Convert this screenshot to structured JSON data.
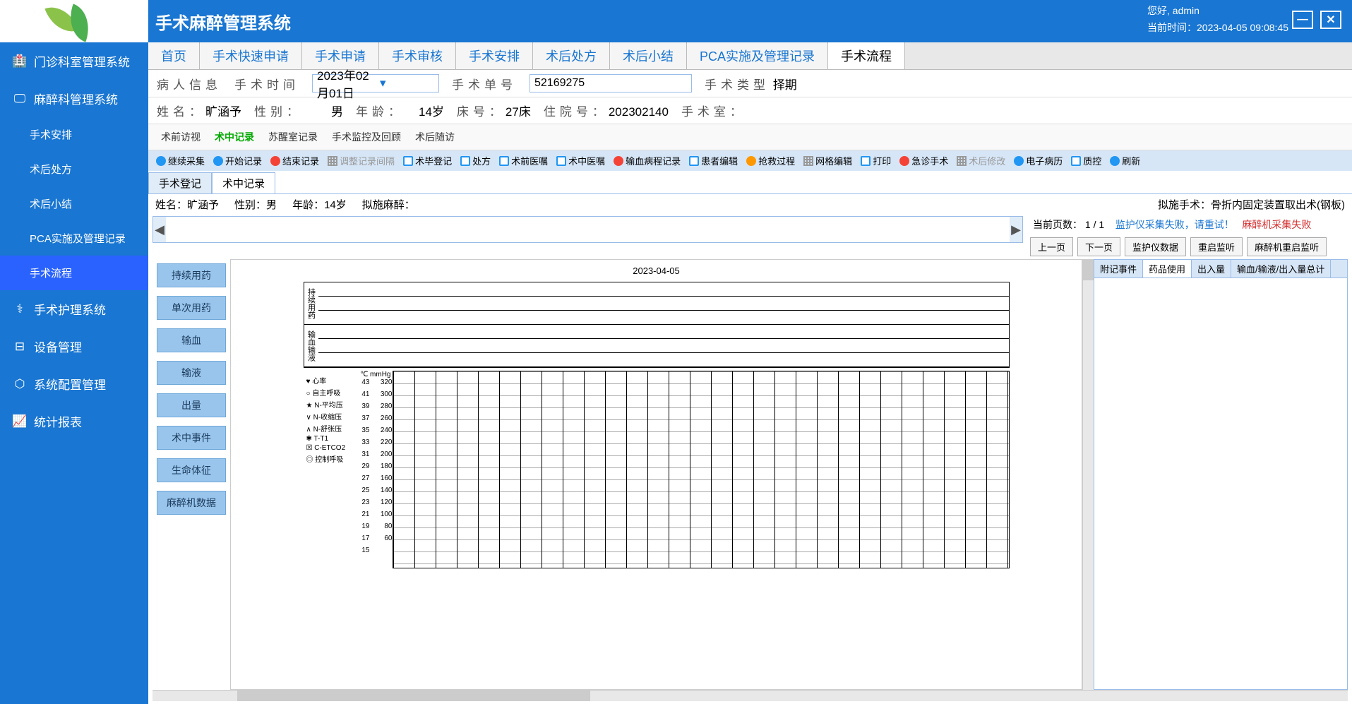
{
  "header": {
    "title": "手术麻醉管理系统",
    "greeting": "您好, admin",
    "time_label": "当前时间：",
    "time_value": "2023-04-05 09:08:45"
  },
  "sidebar": {
    "items": [
      {
        "label": "门诊科室管理系统",
        "icon": "hospital"
      },
      {
        "label": "麻醉科管理系统",
        "icon": "monitor",
        "expanded": true
      },
      {
        "label": "手术安排",
        "sub": true
      },
      {
        "label": "术后处方",
        "sub": true
      },
      {
        "label": "术后小结",
        "sub": true
      },
      {
        "label": "PCA实施及管理记录",
        "sub": true
      },
      {
        "label": "手术流程",
        "sub": true,
        "active": true
      },
      {
        "label": "手术护理系统",
        "icon": "nurse"
      },
      {
        "label": "设备管理",
        "icon": "device"
      },
      {
        "label": "系统配置管理",
        "icon": "config"
      },
      {
        "label": "统计报表",
        "icon": "stats"
      }
    ]
  },
  "main_tabs": [
    "首页",
    "手术快速申请",
    "手术申请",
    "手术审核",
    "手术安排",
    "术后处方",
    "术后小结",
    "PCA实施及管理记录",
    "手术流程"
  ],
  "main_tab_active": 8,
  "patient_info": {
    "section_label": "病人信息",
    "surgery_time_label": "手术时间",
    "surgery_time": "2023年02月01日",
    "surgery_no_label": "手术单号",
    "surgery_no": "52169275",
    "surgery_type_label": "手术类型",
    "surgery_type": "择期",
    "name_label": "姓名：",
    "name": "旷涵予",
    "gender_label": "性别：",
    "gender": "男",
    "age_label": "年龄：",
    "age": "14岁",
    "bed_label": "床号：",
    "bed": "27床",
    "inpatient_label": "住院号：",
    "inpatient": "202302140",
    "room_label": "手术室："
  },
  "sub_tabs": [
    "术前访视",
    "术中记录",
    "苏醒室记录",
    "手术监控及回顾",
    "术后随访"
  ],
  "sub_tab_active": 1,
  "toolbar": [
    {
      "label": "继续采集",
      "icon": "t-blue"
    },
    {
      "label": "开始记录",
      "icon": "t-blue"
    },
    {
      "label": "结束记录",
      "icon": "t-red"
    },
    {
      "label": "调整记录间隔",
      "icon": "t-grid",
      "disabled": true
    },
    {
      "label": "术毕登记",
      "icon": "t-box"
    },
    {
      "label": "处方",
      "icon": "t-box"
    },
    {
      "label": "术前医嘱",
      "icon": "t-box"
    },
    {
      "label": "术中医嘱",
      "icon": "t-box"
    },
    {
      "label": "输血病程记录",
      "icon": "t-red"
    },
    {
      "label": "患者编辑",
      "icon": "t-box"
    },
    {
      "label": "抢救过程",
      "icon": "t-orange"
    },
    {
      "label": "网格编辑",
      "icon": "t-grid"
    },
    {
      "label": "打印",
      "icon": "t-box"
    },
    {
      "label": "急诊手术",
      "icon": "t-red"
    },
    {
      "label": "术后修改",
      "icon": "t-grid",
      "disabled": true
    },
    {
      "label": "电子病历",
      "icon": "t-blue"
    },
    {
      "label": "质控",
      "icon": "t-box"
    },
    {
      "label": "刷新",
      "icon": "t-blue"
    }
  ],
  "doc_tabs": [
    "手术登记",
    "术中记录"
  ],
  "doc_tab_active": 1,
  "pt_bar": {
    "name_label": "姓名：",
    "name": "旷涵予",
    "gender_label": "性别：",
    "gender": "男",
    "age_label": "年龄：",
    "age": "14岁",
    "anesth_label": "拟施麻醉：",
    "surgery_label": "拟施手术：",
    "surgery": "骨折内固定装置取出术(钢板)"
  },
  "nav": {
    "page_label": "当前页数：",
    "page": "1 / 1",
    "warn1": "监护仪采集失败，请重试！",
    "warn2": "麻醉机采集失败",
    "btns": [
      "上一页",
      "下一页",
      "监护仪数据",
      "重启监听",
      "麻醉机重启监听"
    ]
  },
  "med_buttons": [
    "持续用药",
    "单次用药",
    "输血",
    "输液",
    "出量",
    "术中事件",
    "生命体征",
    "麻醉机数据"
  ],
  "chart": {
    "date": "2023-04-05",
    "row_groups": [
      "持续用药",
      "输血输液"
    ],
    "legend": [
      "♥ 心率",
      "○ 自主呼吸",
      "★ N-平均压",
      "∨ N-收缩压",
      "∧ N-舒张压",
      "✱ T-T1",
      "☒ C-ETCO2",
      "◎ 控制呼吸"
    ],
    "y1_unit": "℃",
    "y2_unit": "mmHg",
    "y1": [
      "43",
      "41",
      "39",
      "37",
      "35",
      "33",
      "31",
      "29",
      "27",
      "25",
      "23",
      "21",
      "19",
      "17",
      "15"
    ],
    "y2": [
      "320",
      "300",
      "280",
      "260",
      "240",
      "220",
      "200",
      "180",
      "160",
      "140",
      "120",
      "100",
      "80",
      "60",
      ""
    ]
  },
  "right_tabs": [
    "附记事件",
    "药品使用",
    "出入量",
    "输血/输液/出入量总计"
  ],
  "right_tab_active": 1
}
